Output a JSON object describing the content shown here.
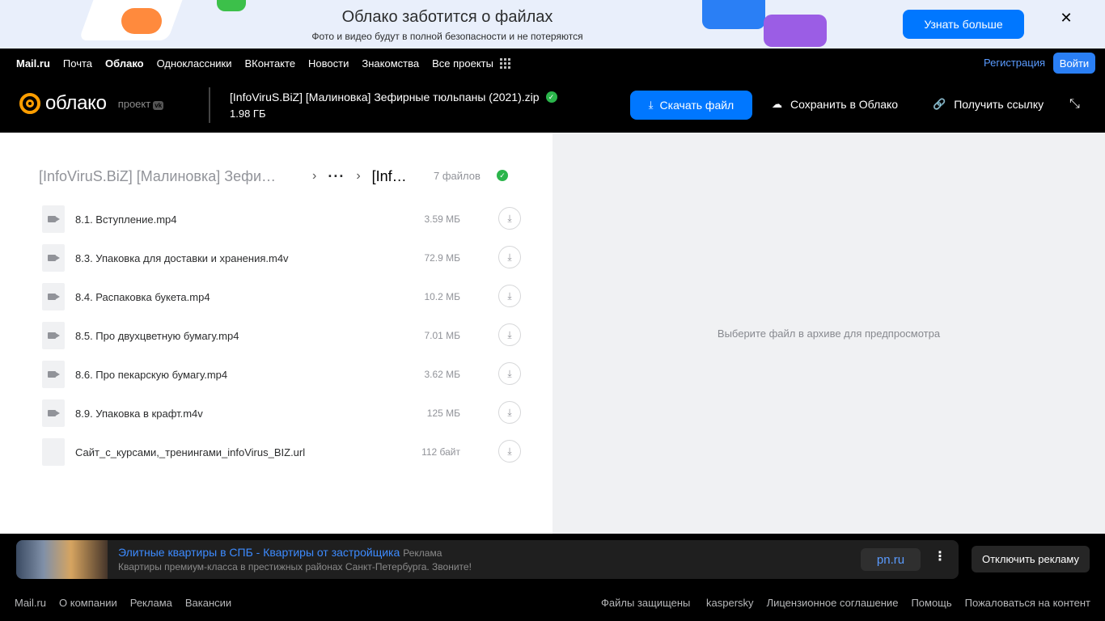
{
  "promo": {
    "title": "Облако заботится о файлах",
    "subtitle": "Фото и видео будут в полной безопасности и не потеряются",
    "button": "Узнать больше",
    "close": "✕"
  },
  "topnav": {
    "links": [
      "Mail.ru",
      "Почта",
      "Облако",
      "Одноклассники",
      "ВКонтакте",
      "Новости",
      "Знакомства",
      "Все проекты"
    ],
    "register": "Регистрация",
    "login": "Войти"
  },
  "header": {
    "logo_text": "облако",
    "project_label": "проект",
    "project_badge": "vk",
    "file_name": "[InfoViruS.BiZ] [Малиновка] Зефирные тюльпаны (2021).zip",
    "file_size": "1.98 ГБ",
    "download_button": "Скачать файл",
    "save_button": "Сохранить в Облако",
    "link_button": "Получить ссылку"
  },
  "archive": {
    "breadcrumb_root": "[InfoViruS.BiZ] [Малиновка] Зефи…",
    "breadcrumb_ellipsis": "···",
    "breadcrumb_current": "[Inf…",
    "file_count": "7 файлов",
    "files": [
      {
        "name": "8.1. Вступление.mp4",
        "size": "3.59 МБ",
        "type": "video"
      },
      {
        "name": "8.3. Упаковка для доставки и хранения.m4v",
        "size": "72.9 МБ",
        "type": "video"
      },
      {
        "name": "8.4. Распаковка букета.mp4",
        "size": "10.2 МБ",
        "type": "video"
      },
      {
        "name": "8.5. Про двухцветную бумагу.mp4",
        "size": "7.01 МБ",
        "type": "video"
      },
      {
        "name": "8.6. Про пекарскую бумагу.mp4",
        "size": "3.62 МБ",
        "type": "video"
      },
      {
        "name": "8.9. Упаковка в крафт.m4v",
        "size": "125 МБ",
        "type": "video"
      },
      {
        "name": "Сайт_с_курсами,_тренингами_infoVirus_BIZ.url",
        "size": "112 байт",
        "type": "file"
      }
    ]
  },
  "preview": {
    "placeholder": "Выберите файл в архиве для предпросмотра"
  },
  "ad": {
    "title": "Элитные квартиры в СПБ - Квартиры от застройщика",
    "tag": "Реклама",
    "subtitle": "Квартиры премиум-класса в престижных районах Санкт-Петербурга. Звоните!",
    "domain": "pn.ru",
    "disable": "Отключить рекламу"
  },
  "footer": {
    "left": [
      "Mail.ru",
      "О компании",
      "Реклама",
      "Вакансии"
    ],
    "protected_prefix": "Файлы защищены",
    "protected_brand": "kaspersky",
    "right": [
      "Лицензионное соглашение",
      "Помощь",
      "Пожаловаться на контент"
    ]
  },
  "colors": {
    "accent": "#0077ff",
    "logo": "#ff9e00",
    "verified": "#2bb54b"
  }
}
